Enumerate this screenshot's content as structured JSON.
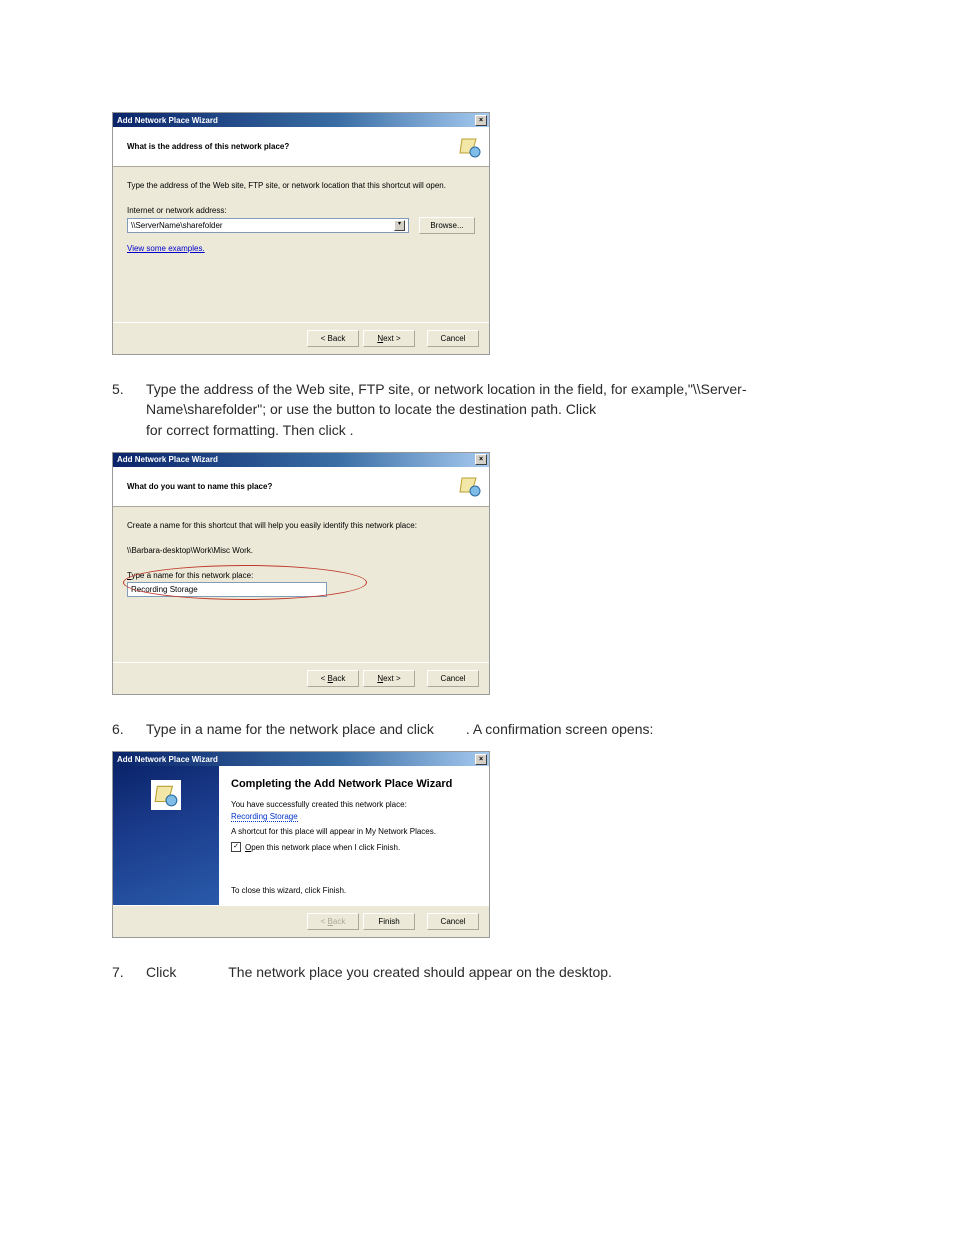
{
  "dialog1": {
    "window_title": "Add Network Place Wizard",
    "header_title": "What is the address of this network place?",
    "intro": "Type the address of the Web site, FTP site, or network location that this shortcut will open.",
    "field_label": "Internet or network address:",
    "input_value": "\\\\ServerName\\sharefolder",
    "browse_button": "Browse...",
    "examples_link": "View some examples.",
    "back_button": "< Back",
    "next_button": "Next >",
    "cancel_button": "Cancel"
  },
  "step5": {
    "num": "5.",
    "text_a": "Type the address of the Web site, FTP site, or network location in the field, for example,\"\\\\Server-Name\\sharefolder\"; or use the ",
    "text_b": " button to locate the destination path. Click ",
    "text_c": "for correct formatting. Then click ",
    "text_d": "."
  },
  "dialog2": {
    "window_title": "Add Network Place Wizard",
    "header_title": "What do you want to name this place?",
    "intro": "Create a name for this shortcut that will help you easily identify this network place:",
    "path_line": "\\\\Barbara-desktop\\Work\\Misc Work.",
    "field_label": "Type a name for this network place:",
    "input_value": "Recording Storage",
    "back_button": "< Back",
    "next_button": "Next >",
    "cancel_button": "Cancel"
  },
  "step6": {
    "num": "6.",
    "text_a": "Type in a name for the network place and click ",
    "text_b": ". A confirmation screen opens:"
  },
  "dialog3": {
    "window_title": "Add Network Place Wizard",
    "confirm_title": "Completing the Add Network Place Wizard",
    "success_text": "You have successfully created this network place:",
    "place_name": "Recording Storage",
    "shortcut_text": "A shortcut for this place will appear in My Network Places.",
    "checkbox_label": "Open this network place when I click Finish.",
    "close_instruction": "To close this wizard, click Finish.",
    "back_button": "< Back",
    "finish_button": "Finish",
    "cancel_button": "Cancel"
  },
  "step7": {
    "num": "7.",
    "text_a": "Click ",
    "text_b": "The network place you created should appear on the desktop."
  }
}
